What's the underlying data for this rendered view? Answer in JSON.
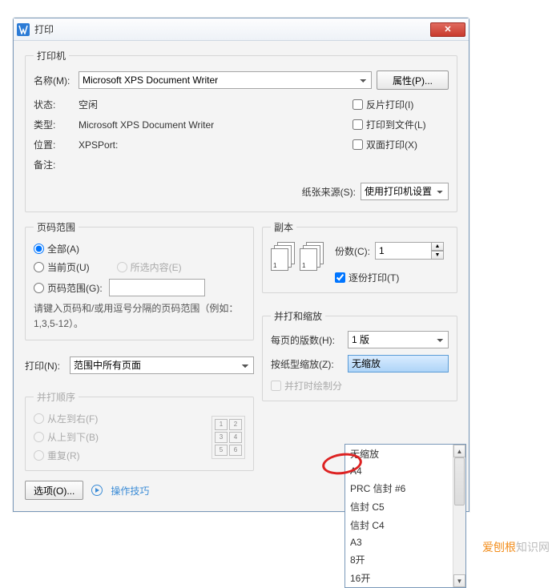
{
  "titlebar": {
    "title": "打印"
  },
  "printer": {
    "legend": "打印机",
    "name_label": "名称(M):",
    "name_value": "Microsoft XPS Document Writer",
    "props_btn": "属性(P)...",
    "status_label": "状态:",
    "status_value": "空闲",
    "type_label": "类型:",
    "type_value": "Microsoft XPS Document Writer",
    "where_label": "位置:",
    "where_value": "XPSPort:",
    "comment_label": "备注:",
    "reverse_label": "反片打印(I)",
    "tofile_label": "打印到文件(L)",
    "duplex_label": "双面打印(X)",
    "paper_src_label": "纸张来源(S):",
    "paper_src_value": "使用打印机设置"
  },
  "range": {
    "legend": "页码范围",
    "all": "全部(A)",
    "current": "当前页(U)",
    "selection": "所选内容(E)",
    "pages": "页码范围(G):",
    "hint": "请键入页码和/或用逗号分隔的页码范围（例如：1,3,5-12）。"
  },
  "print_what": {
    "label": "打印(N):",
    "value": "范围中所有页面"
  },
  "order": {
    "legend": "并打顺序",
    "lr": "从左到右(F)",
    "tb": "从上到下(B)",
    "repeat": "重复(R)"
  },
  "copies": {
    "legend": "副本",
    "count_label": "份数(C):",
    "count_value": "1",
    "collate": "逐份打印(T)"
  },
  "merge": {
    "legend": "并打和缩放",
    "per_label": "每页的版数(H):",
    "per_value": "1 版",
    "zoom_label": "按纸型缩放(Z):",
    "zoom_value": "无缩放",
    "border": "并打时绘制分"
  },
  "bottom": {
    "options": "选项(O)...",
    "tips": "操作技巧"
  },
  "zoom_options": [
    "无缩放",
    "A4",
    "PRC 信封 #6",
    "信封 C5",
    "信封 C4",
    "A3",
    "8开",
    "16开"
  ],
  "watermark": {
    "t1": "爱刨根",
    "t2": "知识网"
  }
}
